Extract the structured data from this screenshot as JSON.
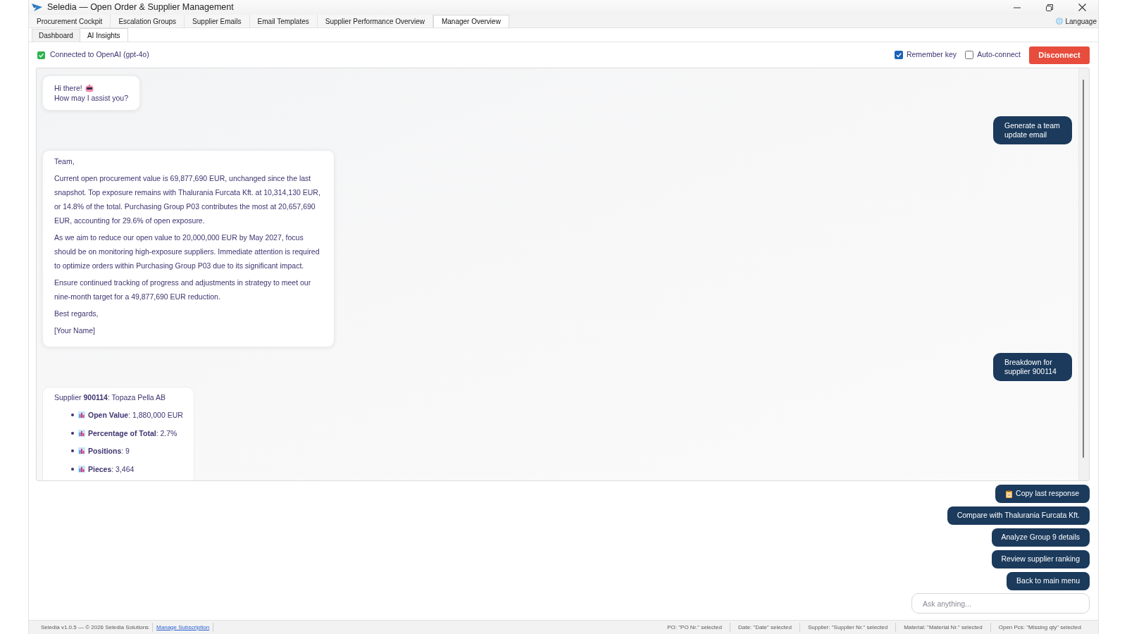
{
  "window": {
    "title": "Seledia — Open Order & Supplier Management"
  },
  "tabs": [
    {
      "label": "Procurement Cockpit",
      "selected": false
    },
    {
      "label": "Escalation Groups",
      "selected": false
    },
    {
      "label": "Supplier Emails",
      "selected": false
    },
    {
      "label": "Email Templates",
      "selected": false
    },
    {
      "label": "Supplier Performance Overview",
      "selected": false
    },
    {
      "label": "Manager Overview",
      "selected": true
    }
  ],
  "language": {
    "label": "Language"
  },
  "subtabs": [
    {
      "label": "Dashboard",
      "selected": false
    },
    {
      "label": "AI Insights",
      "selected": true
    }
  ],
  "connection": {
    "status": "Connected to OpenAI (gpt-4o)",
    "connected": true,
    "options": [
      {
        "label": "Remember key",
        "checked": true
      },
      {
        "label": "Auto-connect",
        "checked": false
      }
    ],
    "button": "Disconnect"
  },
  "chat": {
    "messages": [
      {
        "kind": "greeting",
        "before_icon": "Hi there!",
        "after_icon": "How may I assist you?"
      },
      {
        "kind": "request",
        "text": "Generate a team update email"
      },
      {
        "kind": "email",
        "paragraphs": [
          "Team,",
          "Current open procurement value is 69,877,690 EUR, unchanged since the last snapshot. Top exposure remains with Thalurania Furcata Kft. at 10,314,130 EUR, or 14.8% of the total. Purchasing Group P03 contributes the most at 20,657,690 EUR, accounting for 29.6% of open exposure.",
          "As we aim to reduce our open value to 20,000,000 EUR by May 2027, focus should be on monitoring high-exposure suppliers. Immediate attention is required to optimize orders within Purchasing Group P03 due to its significant impact.",
          "Ensure continued tracking of progress and adjustments in strategy to meet our nine-month target for a 49,877,690 EUR reduction.",
          "Best regards,",
          "[Your Name]"
        ]
      },
      {
        "kind": "request",
        "text": "Breakdown for supplier 900114"
      },
      {
        "kind": "breakdown",
        "heading": "Supplier **900114**: Topaza Pella AB",
        "items": [
          "**Open Value**: 1,880,000 EUR",
          "**Percentage of Total**: 2.7%",
          "**Positions**: 9",
          "**Pieces**: 3,464"
        ]
      }
    ]
  },
  "quick_replies": [
    {
      "kind": "copy",
      "label": "Copy last response"
    },
    {
      "kind": "prompt",
      "label": "Compare with Thalurania Furcata Kft."
    },
    {
      "kind": "prompt",
      "label": "Analyze Group 9 details"
    },
    {
      "kind": "prompt",
      "label": "Review supplier ranking"
    },
    {
      "kind": "prompt",
      "label": "Back to main menu"
    }
  ],
  "input": {
    "placeholder": "Ask anything..."
  },
  "status_bar": {
    "version": "Seledia v1.0.5 — © 2026 Seledia Solutions",
    "link": "Manage Subscription",
    "selections": [
      "PO: \"PO Nr.\" selected",
      "Date: \"Date\" selected",
      "Supplier: \"Supplier Nr.\" selected",
      "Material: \"Material Nr.\" selected",
      "Open Pcs: \"Missing qty\" selected"
    ]
  }
}
